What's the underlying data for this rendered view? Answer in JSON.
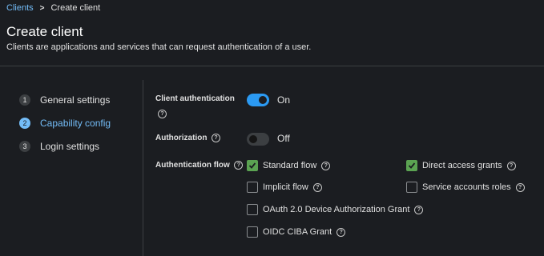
{
  "breadcrumb": {
    "parent": "Clients",
    "separator": ">",
    "current": "Create client"
  },
  "header": {
    "title": "Create client",
    "description": "Clients are applications and services that can request authentication of a user."
  },
  "wizard": {
    "steps": [
      {
        "number": "1",
        "label": "General settings",
        "active": false
      },
      {
        "number": "2",
        "label": "Capability config",
        "active": true
      },
      {
        "number": "3",
        "label": "Login settings",
        "active": false
      }
    ]
  },
  "form": {
    "client_authentication": {
      "label": "Client authentication",
      "help": "?",
      "state": "On",
      "enabled": true
    },
    "authorization": {
      "label": "Authorization",
      "help": "?",
      "state": "Off",
      "enabled": false
    },
    "authentication_flow": {
      "label": "Authentication flow",
      "help": "?",
      "options": [
        {
          "label": "Standard flow",
          "checked": true
        },
        {
          "label": "Direct access grants",
          "checked": true
        },
        {
          "label": "Implicit flow",
          "checked": false
        },
        {
          "label": "Service accounts roles",
          "checked": false
        },
        {
          "label": "OAuth 2.0 Device Authorization Grant",
          "checked": false
        },
        {
          "label": "OIDC CIBA Grant",
          "checked": false
        }
      ]
    }
  },
  "colors": {
    "accent": "#73bcf7",
    "toggle_on": "#2b9af3",
    "checkbox_checked": "#5ba352",
    "background": "#1b1d21"
  }
}
